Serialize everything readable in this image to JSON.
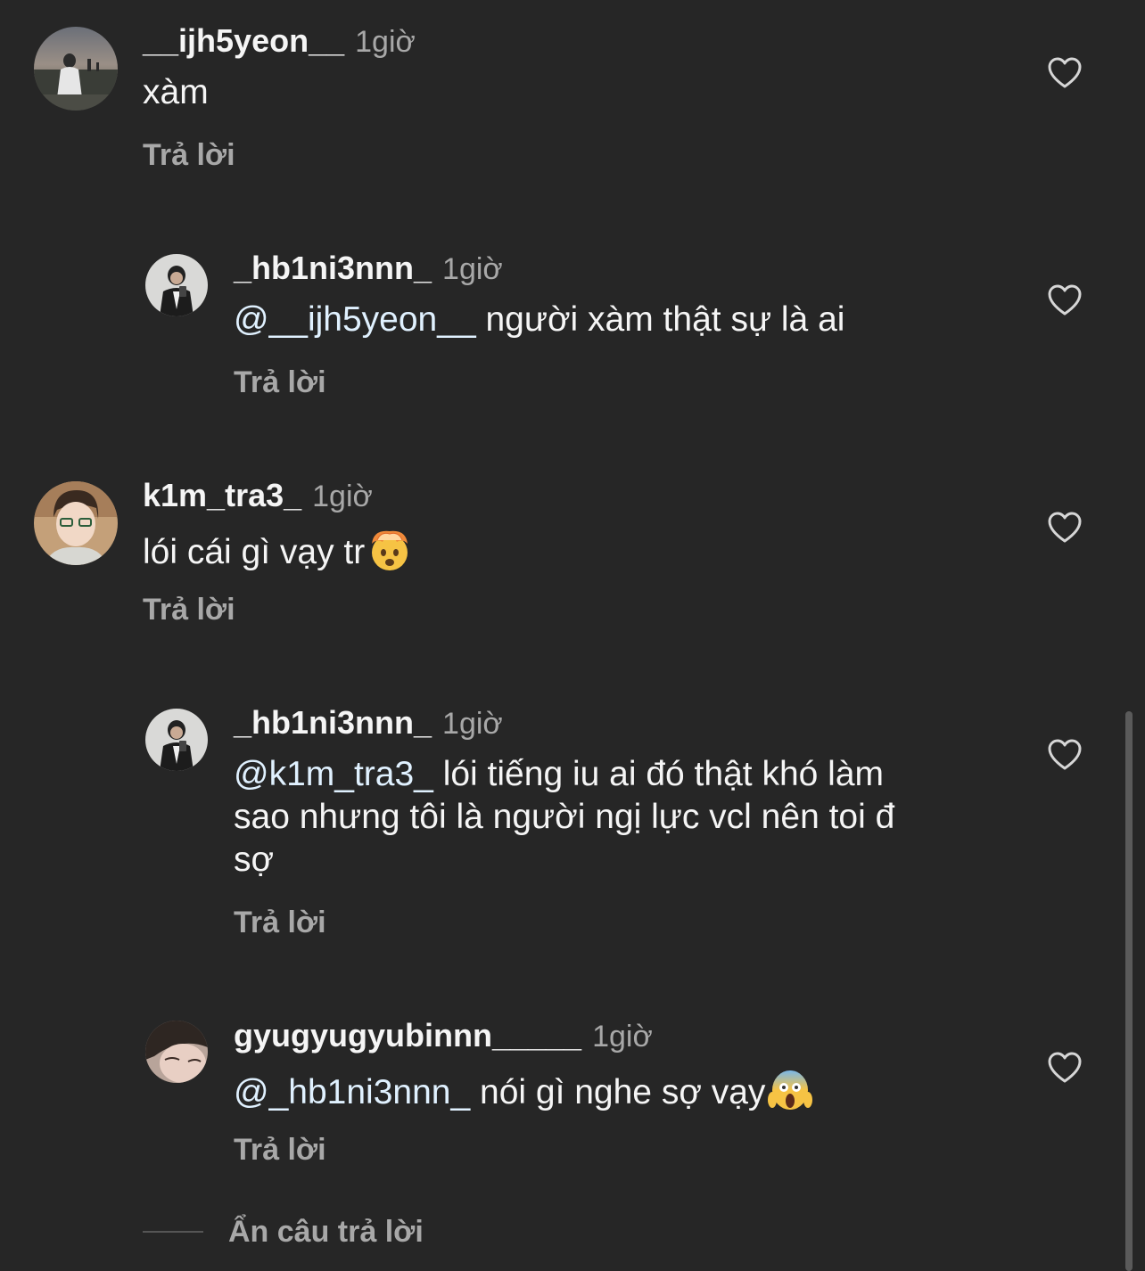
{
  "comments": [
    {
      "username": "__ijh5yeon__",
      "time": "1giờ",
      "text": "xàm",
      "reply_label": "Trả lời"
    },
    {
      "username": "_hb1ni3nnn_",
      "time": "1giờ",
      "mention": "@__ijh5yeon__",
      "text": "người xàm thật sự là ai",
      "reply_label": "Trả lời"
    },
    {
      "username": "k1m_tra3_",
      "time": "1giờ",
      "text": "lói cái gì vạy tr",
      "emoji": "exploding-head-emoji",
      "reply_label": "Trả lời"
    },
    {
      "username": "_hb1ni3nnn_",
      "time": "1giờ",
      "mention": "@k1m_tra3_",
      "text_line1": "lói tiếng iu ai đó thật khó làm",
      "text_line2": "sao nhưng tôi là người ngị lực vcl nên toi đ",
      "text_line3": "sợ",
      "reply_label": "Trả lời"
    },
    {
      "username": "gyugyugyubinnn_____",
      "time": "1giờ",
      "mention": "@_hb1ni3nnn_",
      "text": "nói gì nghe sợ vạy",
      "emoji": "screaming-face-emoji",
      "reply_label": "Trả lời"
    }
  ],
  "hide_replies_label": "Ẩn câu trả lời",
  "icons": {
    "like": "heart-outline-icon"
  },
  "colors": {
    "background": "#262626",
    "text": "#f5f5f5",
    "secondary": "#a8a8a8",
    "mention": "#e0f1ff"
  }
}
